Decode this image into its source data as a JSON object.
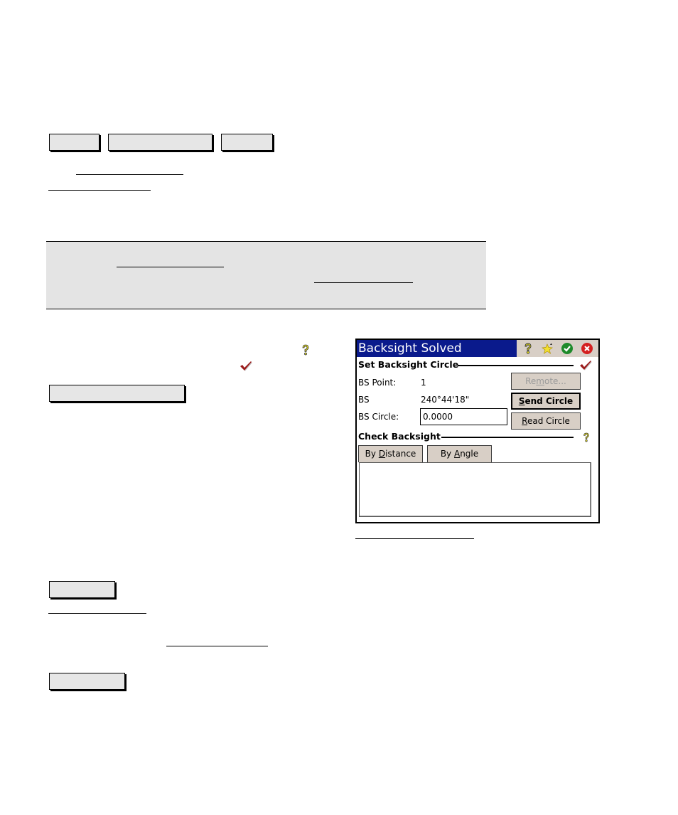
{
  "document": {
    "top_buttons": [
      {
        "label": ""
      },
      {
        "label": ""
      },
      {
        "label": ""
      }
    ],
    "links": {
      "link_1": "",
      "link_2": "",
      "note_link_1": "",
      "note_link_2": "",
      "figure_caption_link": "",
      "link_3": "",
      "link_4": ""
    },
    "note_box": {
      "text": ""
    },
    "mid_button": {
      "label": ""
    },
    "lower_buttons": [
      {
        "label": ""
      },
      {
        "label": ""
      }
    ],
    "inline_icons": [
      "help-icon",
      "checkmark-icon"
    ]
  },
  "device_screen": {
    "title": "Backsight Solved",
    "title_icons": [
      "help-icon",
      "favorites-star-icon",
      "ok-green-check-icon",
      "close-red-x-icon"
    ],
    "colors": {
      "titlebar": "#0a1a8c",
      "button_face": "#d8cfc6",
      "check_mark": "#9b1b1b",
      "ok_green": "#1e8a2a",
      "close_red": "#d42020",
      "help_yellow": "#e8e020"
    },
    "set_backsight": {
      "header": "Set Backsight Circle",
      "status_icon": "checkmark-icon",
      "fields": [
        {
          "label": "BS Point:",
          "value": "1"
        },
        {
          "label": "BS",
          "value": "240°44'18\""
        },
        {
          "label": "BS Circle:",
          "value": "0.0000"
        }
      ],
      "buttons": {
        "remote": {
          "label_pre": "Re",
          "label_ul": "m",
          "label_post": "ote...",
          "enabled": false
        },
        "send_circle": {
          "label_pre": "",
          "label_ul": "S",
          "label_post": "end Circle",
          "default": true
        },
        "read_circle": {
          "label_pre": "",
          "label_ul": "R",
          "label_post": "ead Circle"
        }
      }
    },
    "check_backsight": {
      "header": "Check Backsight",
      "help_icon": "help-icon",
      "tabs": [
        {
          "label_pre": "By ",
          "label_ul": "D",
          "label_post": "istance"
        },
        {
          "label_pre": "By ",
          "label_ul": "A",
          "label_post": "ngle"
        }
      ]
    }
  }
}
